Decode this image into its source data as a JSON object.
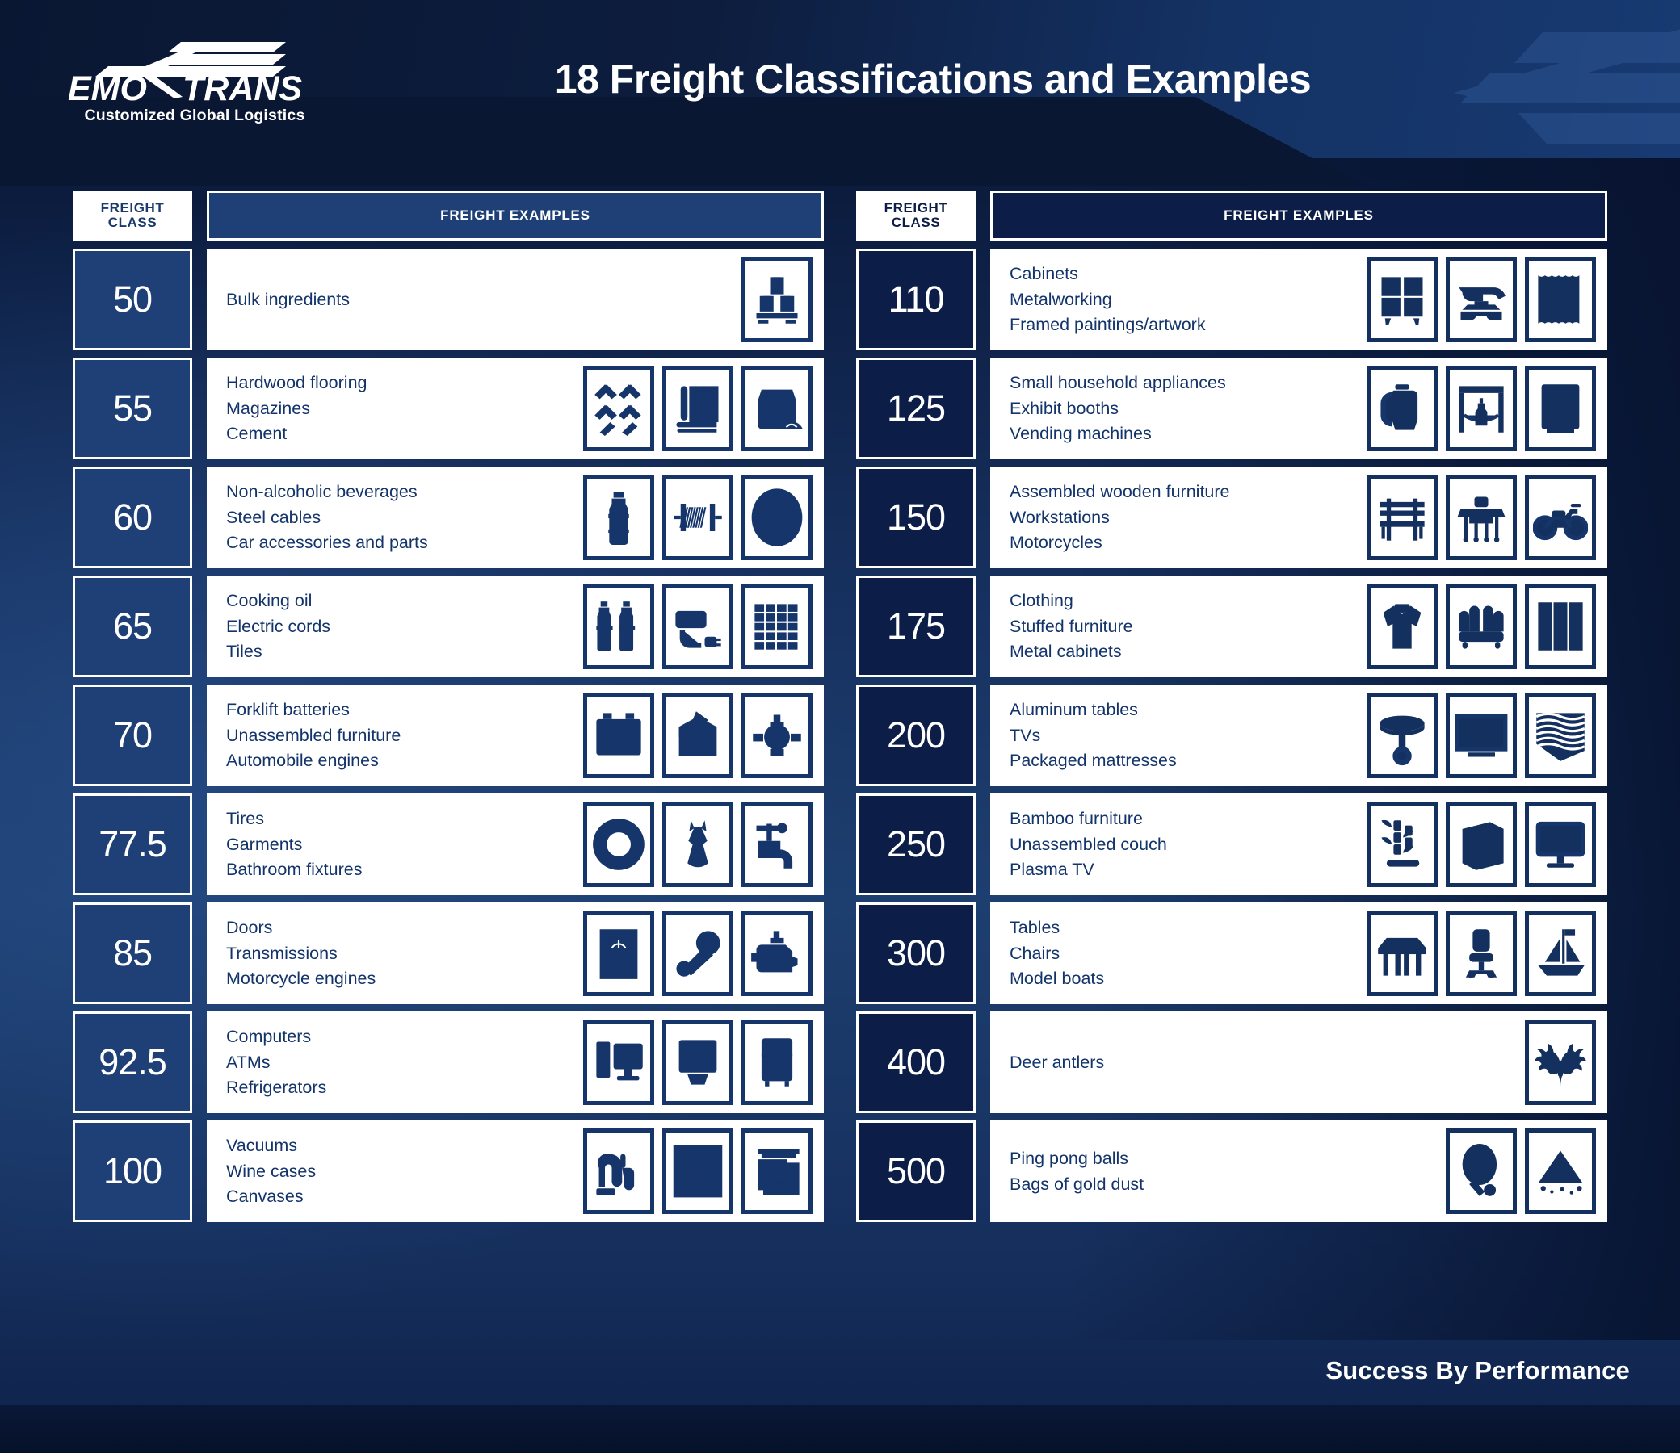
{
  "brand": {
    "logo_text": "EMO TRANS",
    "tagline": "Customized Global Logistics",
    "logo_icon": "wing-arrow-icon"
  },
  "header": {
    "title": "18 Freight Classifications and Examples"
  },
  "footer": {
    "slogan": "Success By Performance"
  },
  "colors": {
    "page_bg_dark": "#0b1b3d",
    "panel_navy_left": "#1e4076",
    "panel_navy_right": "#0c1e47",
    "text_on_white": "#13346b",
    "white": "#ffffff"
  },
  "table_headers": {
    "freight_class_line1": "FREIGHT",
    "freight_class_line2": "CLASS",
    "freight_examples": "FREIGHT EXAMPLES"
  },
  "left_column": [
    {
      "class": "50",
      "examples": [
        "Bulk ingredients"
      ],
      "icons": [
        "palletized-boxes-icon"
      ]
    },
    {
      "class": "55",
      "examples": [
        "Hardwood flooring",
        "Magazines",
        "Cement"
      ],
      "icons": [
        "herringbone-flooring-icon",
        "magazine-icon",
        "cement-bag-icon"
      ]
    },
    {
      "class": "60",
      "examples": [
        "Non-alcoholic beverages",
        "Steel cables",
        "Car accessories and parts"
      ],
      "icons": [
        "water-bottle-icon",
        "cable-spool-icon",
        "steering-wheel-icon"
      ]
    },
    {
      "class": "65",
      "examples": [
        "Cooking oil",
        "Electric cords",
        "Tiles"
      ],
      "icons": [
        "oil-bottles-icon",
        "extension-cord-icon",
        "tiles-icon"
      ]
    },
    {
      "class": "70",
      "examples": [
        "Forklift batteries",
        "Unassembled furniture",
        "Automobile engines"
      ],
      "icons": [
        "battery-icon",
        "open-box-icon",
        "engine-icon"
      ]
    },
    {
      "class": "77.5",
      "examples": [
        "Tires",
        "Garments",
        "Bathroom fixtures"
      ],
      "icons": [
        "tire-icon",
        "dress-icon",
        "faucet-icon"
      ]
    },
    {
      "class": "85",
      "examples": [
        "Doors",
        "Transmissions",
        "Motorcycle engines"
      ],
      "icons": [
        "door-icon",
        "transmission-icon",
        "motor-icon"
      ]
    },
    {
      "class": "92.5",
      "examples": [
        "Computers",
        "ATMs",
        "Refrigerators"
      ],
      "icons": [
        "desktop-computer-icon",
        "atm-icon",
        "refrigerator-icon"
      ]
    },
    {
      "class": "100",
      "examples": [
        "Vacuums",
        "Wine cases",
        "Canvases"
      ],
      "icons": [
        "vacuum-icon",
        "wine-case-icon",
        "canvas-print-icon"
      ]
    }
  ],
  "right_column": [
    {
      "class": "110",
      "examples": [
        "Cabinets",
        "Metalworking",
        "Framed paintings/artwork"
      ],
      "icons": [
        "cabinet-icon",
        "anvil-icon",
        "framed-artwork-icon"
      ]
    },
    {
      "class": "125",
      "examples": [
        "Small household appliances",
        "Exhibit booths",
        "Vending machines"
      ],
      "icons": [
        "kettle-icon",
        "exhibit-booth-icon",
        "vending-machine-icon"
      ]
    },
    {
      "class": "150",
      "examples": [
        "Assembled wooden furniture",
        "Workstations",
        "Motorcycles"
      ],
      "icons": [
        "bench-icon",
        "workstation-desk-icon",
        "motorcycle-icon"
      ]
    },
    {
      "class": "175",
      "examples": [
        "Clothing",
        "Stuffed furniture",
        "Metal cabinets"
      ],
      "icons": [
        "sweater-icon",
        "armchair-icon",
        "lockers-icon"
      ]
    },
    {
      "class": "200",
      "examples": [
        "Aluminum tables",
        "TVs",
        "Packaged mattresses"
      ],
      "icons": [
        "round-table-icon",
        "television-icon",
        "rolled-mattress-icon"
      ]
    },
    {
      "class": "250",
      "examples": [
        "Bamboo furniture",
        "Unassembled couch",
        "Plasma TV"
      ],
      "icons": [
        "bamboo-icon",
        "couch-in-box-icon",
        "flatscreen-tv-icon"
      ]
    },
    {
      "class": "300",
      "examples": [
        "Tables",
        "Chairs",
        "Model boats"
      ],
      "icons": [
        "table-icon",
        "office-chair-icon",
        "sailboat-icon"
      ]
    },
    {
      "class": "400",
      "examples": [
        "Deer antlers"
      ],
      "icons": [
        "antlers-icon"
      ]
    },
    {
      "class": "500",
      "examples": [
        "Ping pong balls",
        "Bags of gold dust"
      ],
      "icons": [
        "ping-pong-paddle-icon",
        "gold-dust-pile-icon"
      ]
    }
  ]
}
